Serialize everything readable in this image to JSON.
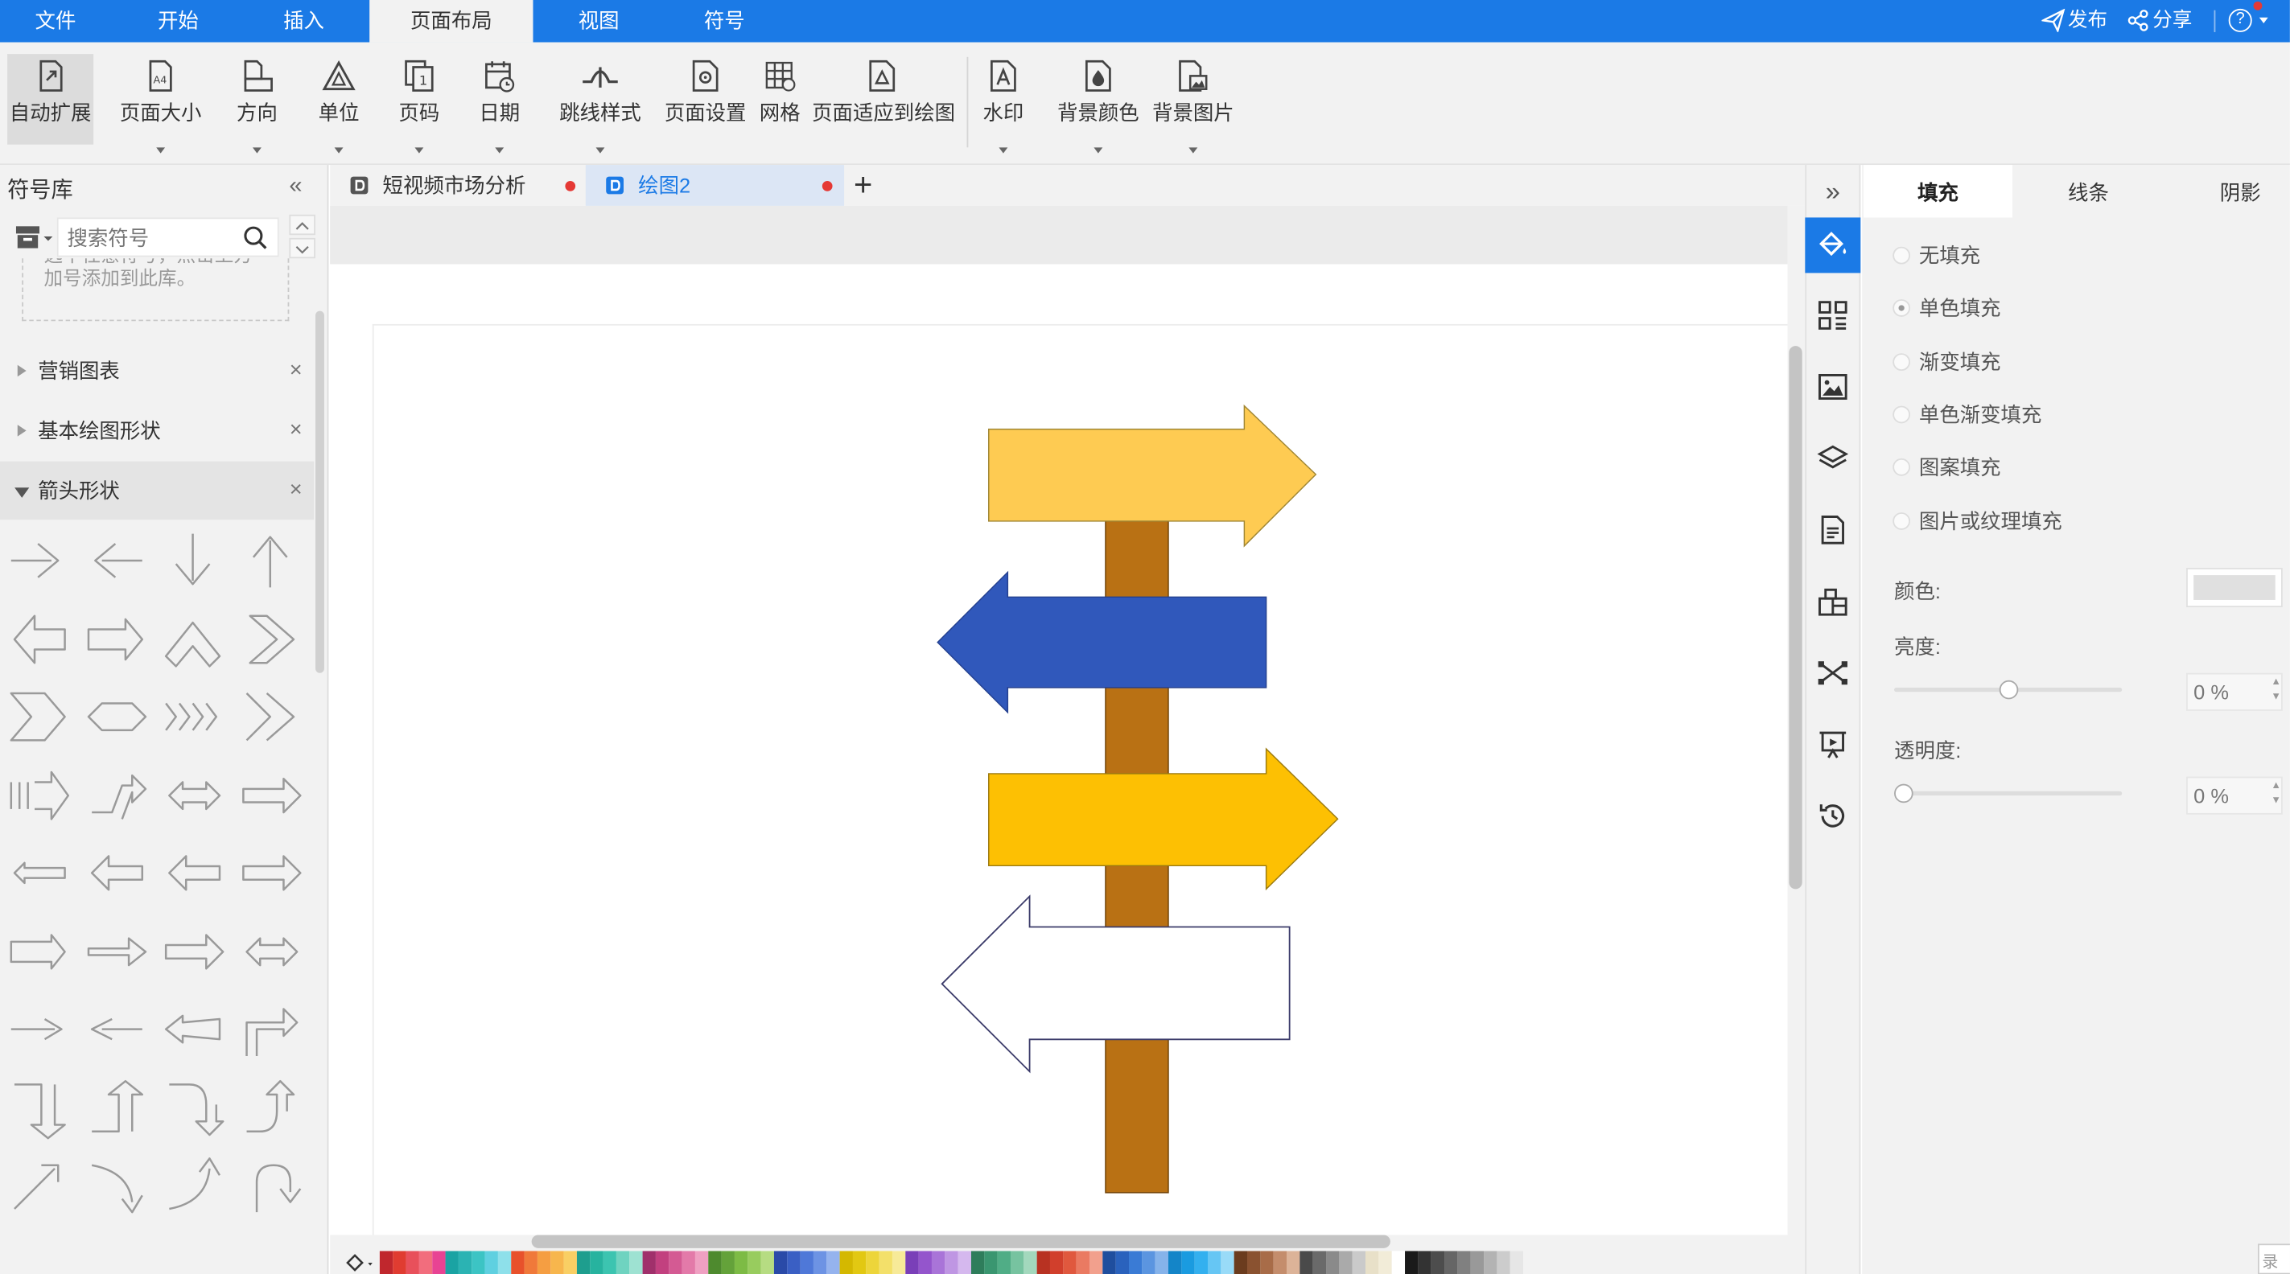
{
  "menu": {
    "tabs": [
      "文件",
      "开始",
      "插入",
      "页面布局",
      "视图",
      "符号"
    ],
    "active": "页面布局",
    "publish": "发布",
    "share": "分享",
    "help": "?"
  },
  "ribbon": {
    "buttons": [
      "自动扩展",
      "页面大小",
      "方向",
      "单位",
      "页码",
      "日期",
      "跳线样式",
      "页面设置",
      "网格",
      "页面适应到绘图",
      "水印",
      "背景颜色",
      "背景图片"
    ]
  },
  "left_panel": {
    "title": "符号库",
    "search_placeholder": "搜索符号",
    "hint_line1": "选中任意符号，点击上方",
    "hint_line2": "加号添加到此库。",
    "sections": [
      "营销图表",
      "基本绘图形状",
      "箭头形状"
    ],
    "close_glyph": "×"
  },
  "tabs": {
    "doc1": "短视频市场分析",
    "doc2": "绘图2",
    "add": "+"
  },
  "right_panel": {
    "tabs": [
      "填充",
      "线条",
      "阴影"
    ],
    "fill_options": [
      "无填充",
      "单色填充",
      "渐变填充",
      "单色渐变填充",
      "图案填充",
      "图片或纹理填充"
    ],
    "selected_option": "单色填充",
    "color_label": "颜色:",
    "brightness_label": "亮度:",
    "brightness_value": "0 %",
    "brightness_level": 0.5,
    "opacity_label": "透明度:",
    "opacity_value": "0 %",
    "opacity_level": 0
  },
  "canvas": {
    "post_color": "#b97114",
    "sign_colors": [
      "#fecb52",
      "#3058bb",
      "#fdc003",
      "#ffffff"
    ]
  },
  "statusbar": {
    "corner": "录"
  }
}
